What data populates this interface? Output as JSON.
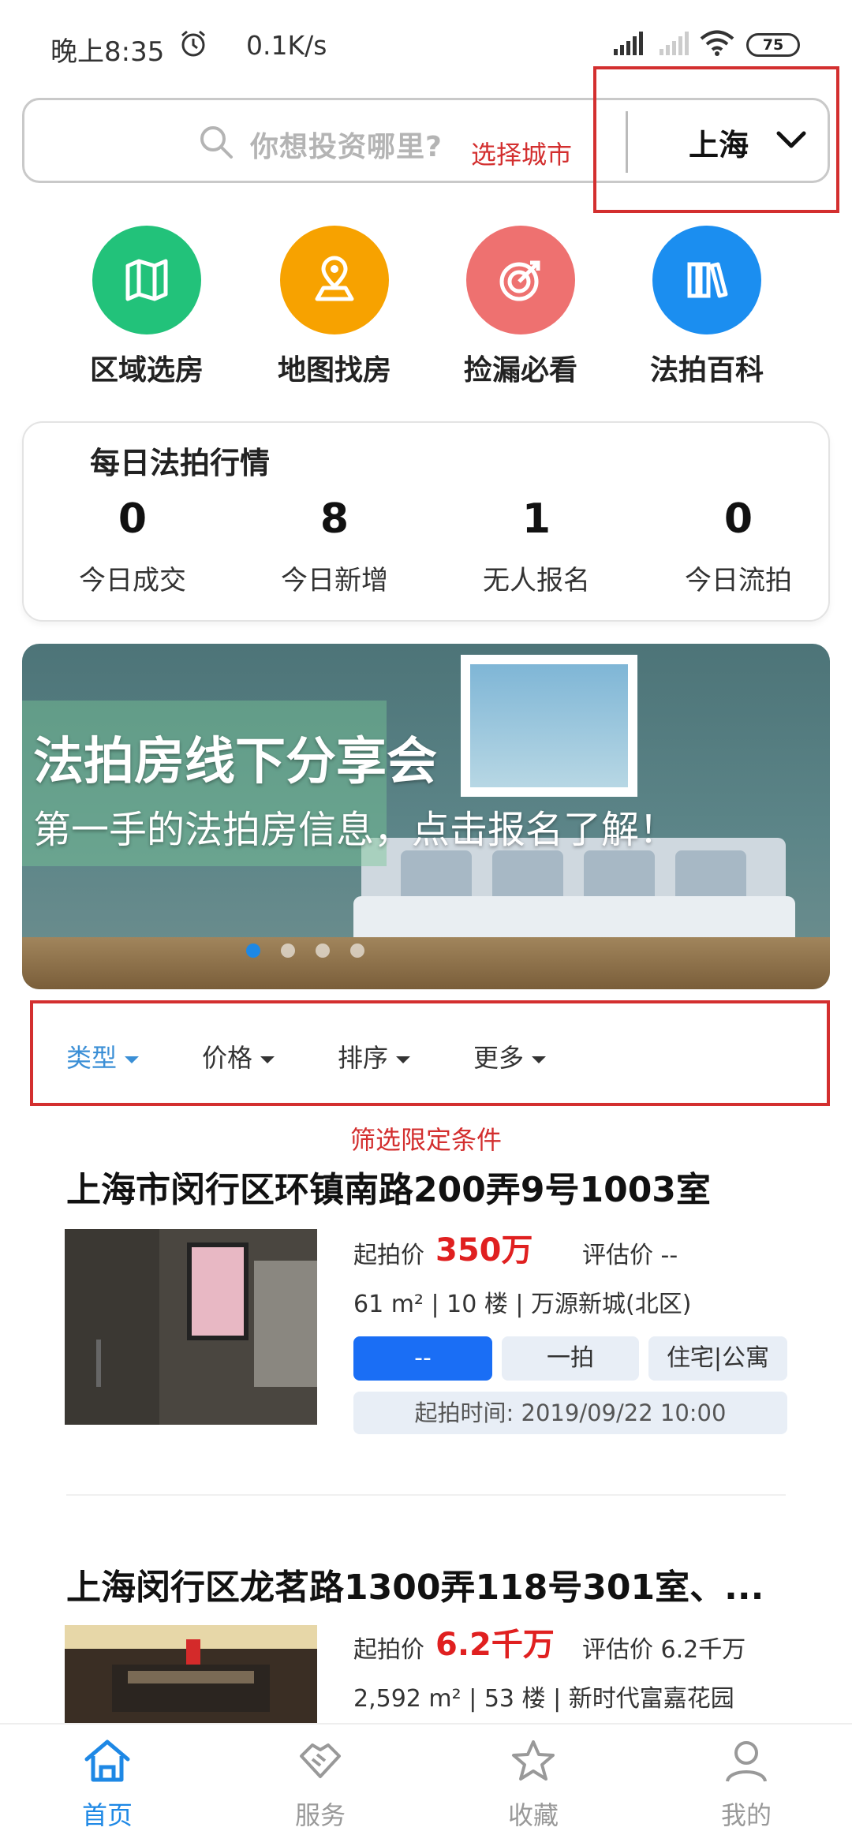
{
  "status_bar": {
    "time": "晚上8:35",
    "speed": "0.1K/s",
    "battery": "75"
  },
  "search": {
    "placeholder": "你想投资哪里?",
    "annotation": "选择城市",
    "city": "上海"
  },
  "quick_nav": [
    {
      "label": "区域选房",
      "icon": "map-icon",
      "color": "#22c27a"
    },
    {
      "label": "地图找房",
      "icon": "location-pin-icon",
      "color": "#f7a200"
    },
    {
      "label": "捡漏必看",
      "icon": "target-icon",
      "color": "#ee7170"
    },
    {
      "label": "法拍百科",
      "icon": "books-icon",
      "color": "#1b8ef0"
    }
  ],
  "daily_stats": {
    "title": "每日法拍行情",
    "items": [
      {
        "value": "0",
        "label": "今日成交"
      },
      {
        "value": "8",
        "label": "今日新增"
      },
      {
        "value": "1",
        "label": "无人报名"
      },
      {
        "value": "0",
        "label": "今日流拍"
      }
    ]
  },
  "banner": {
    "title": "法拍房线下分享会",
    "subtitle": "第一手的法拍房信息，点击报名了解！",
    "slide_count": 4,
    "active_slide": 1
  },
  "filters": {
    "items": [
      {
        "label": "类型",
        "active": true
      },
      {
        "label": "价格",
        "active": false
      },
      {
        "label": "排序",
        "active": false
      },
      {
        "label": "更多",
        "active": false
      }
    ],
    "annotation": "筛选限定条件"
  },
  "listings": [
    {
      "title": "上海市闵行区环镇南路200弄9号1003室",
      "price_label": "起拍价",
      "price": "350万",
      "estimate": "评估价 --",
      "specs": "61 m² | 10 楼 | 万源新城(北区)",
      "status_tag": "--",
      "round_tag": "一拍",
      "type_tag": "住宅|公寓",
      "start_time": "起拍时间: 2019/09/22 10:00"
    },
    {
      "title": "上海闵行区龙茗路1300弄118号301室、...",
      "price_label": "起拍价",
      "price": "6.2千万",
      "estimate": "评估价 6.2千万",
      "specs": "2,592 m² | 53 楼 | 新时代富嘉花园"
    }
  ],
  "bottom_nav": [
    {
      "label": "首页",
      "icon": "home-icon",
      "active": true
    },
    {
      "label": "服务",
      "icon": "handshake-icon",
      "active": false
    },
    {
      "label": "收藏",
      "icon": "star-icon",
      "active": false
    },
    {
      "label": "我的",
      "icon": "user-icon",
      "active": false
    }
  ],
  "colors": {
    "accent": "#1e88e5",
    "price": "#e02020",
    "annotation": "#d32f2f"
  }
}
